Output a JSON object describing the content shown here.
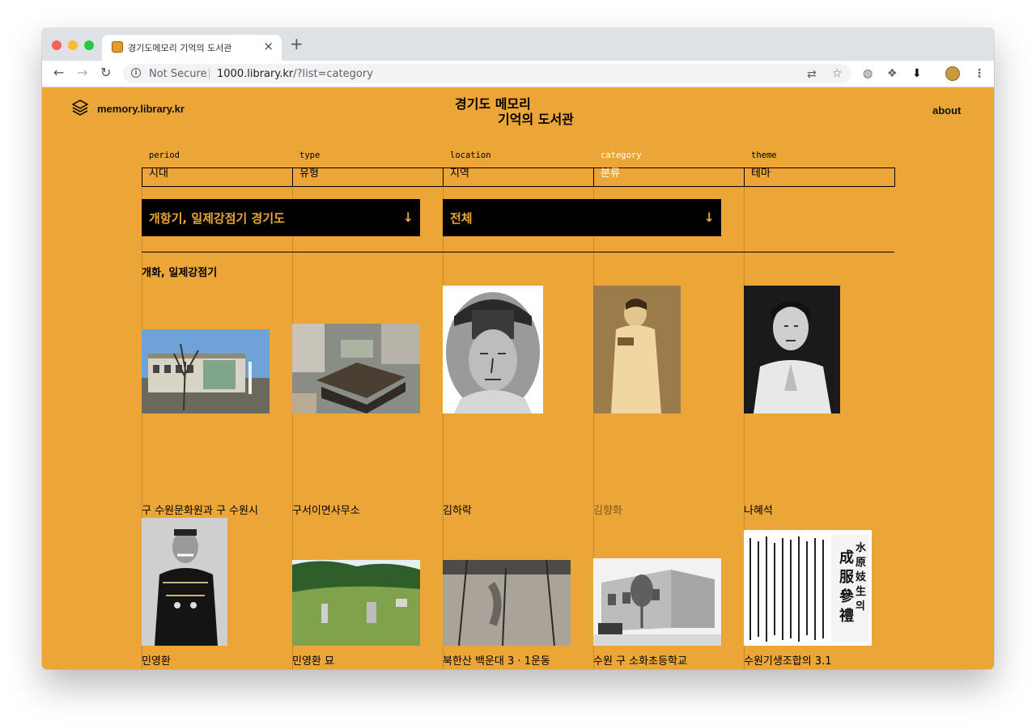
{
  "browser": {
    "tab_title": "경기도메모리 기억의 도서관",
    "tab_close": "×",
    "new_tab": "+",
    "security_label": "Not Secure",
    "url_host": "1000.library.kr",
    "url_path": "/?list=category"
  },
  "header": {
    "site_name": "memory.library.kr",
    "title_line1": "경기도 메모리",
    "title_line2": "기억의 도서관",
    "about_link": "about"
  },
  "filters": [
    {
      "en": "period",
      "ko": "시대",
      "active": false
    },
    {
      "en": "type",
      "ko": "유형",
      "active": false
    },
    {
      "en": "location",
      "ko": "지역",
      "active": false
    },
    {
      "en": "category",
      "ko": "분류",
      "active": true
    },
    {
      "en": "theme",
      "ko": "테마",
      "active": false
    }
  ],
  "dropdowns": [
    {
      "label": "개항기, 일제강점기 경기도",
      "arrow": "↓"
    },
    {
      "label": "전체",
      "arrow": "↓"
    }
  ],
  "section": {
    "title": "개화, 일제강점기"
  },
  "items": [
    {
      "caption": "구 수원문화원과 구 수원시청사",
      "image": "building-photo",
      "dimmed": false
    },
    {
      "caption": "구서이면사무소",
      "image": "aerial-building-photo",
      "dimmed": false
    },
    {
      "caption": "김하락",
      "image": "portrait-drawing",
      "dimmed": false
    },
    {
      "caption": "김향화",
      "image": "sepia-portrait",
      "dimmed": true
    },
    {
      "caption": "나혜석",
      "image": "bw-portrait",
      "dimmed": false
    },
    {
      "caption": "민영환",
      "image": "military-portrait",
      "dimmed": false
    },
    {
      "caption": "민영환 묘",
      "image": "tomb-photo",
      "dimmed": false
    },
    {
      "caption": "북한산 백운대 3 · 1운동",
      "image": "rock-photo",
      "dimmed": false
    },
    {
      "caption": "수원 구 소화초등학교",
      "image": "school-photo",
      "dimmed": false
    },
    {
      "caption": "수원기생조합의 3.1",
      "image": "newspaper-clipping",
      "dimmed": false
    }
  ],
  "newspaper_text": "水原妓生의成服參禮",
  "colors": {
    "background": "#EBA637",
    "dropdown_bg": "#000000",
    "active_filter": "#FFFFFF"
  }
}
